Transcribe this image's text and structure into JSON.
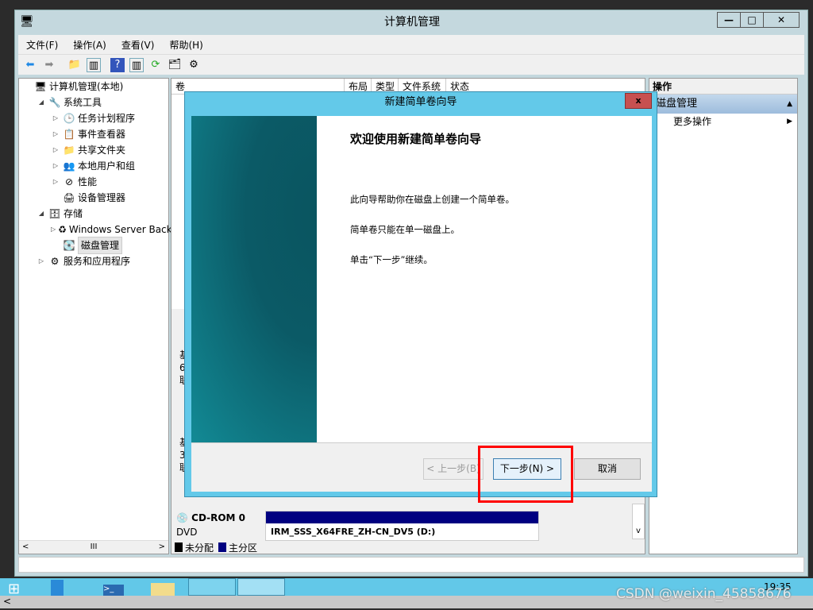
{
  "window": {
    "title": "计算机管理",
    "min": "—",
    "max": "□",
    "close": "✕"
  },
  "menu": [
    "文件(F)",
    "操作(A)",
    "查看(V)",
    "帮助(H)"
  ],
  "tree": [
    {
      "label": "计算机管理(本地)",
      "level": 0,
      "exp": "",
      "icon": "🖥"
    },
    {
      "label": "系统工具",
      "level": 1,
      "exp": "◢",
      "icon": "🔧"
    },
    {
      "label": "任务计划程序",
      "level": 2,
      "exp": "▷",
      "icon": "🕒"
    },
    {
      "label": "事件查看器",
      "level": 2,
      "exp": "▷",
      "icon": "📋"
    },
    {
      "label": "共享文件夹",
      "level": 2,
      "exp": "▷",
      "icon": "📁"
    },
    {
      "label": "本地用户和组",
      "level": 2,
      "exp": "▷",
      "icon": "👥"
    },
    {
      "label": "性能",
      "level": 2,
      "exp": "▷",
      "icon": "⊘"
    },
    {
      "label": "设备管理器",
      "level": 2,
      "exp": "",
      "icon": "🖨"
    },
    {
      "label": "存储",
      "level": 1,
      "exp": "◢",
      "icon": "🗄"
    },
    {
      "label": "Windows Server Back",
      "level": 2,
      "exp": "▷",
      "icon": "♻"
    },
    {
      "label": "磁盘管理",
      "level": 2,
      "exp": "",
      "icon": "💽",
      "selected": true
    },
    {
      "label": "服务和应用程序",
      "level": 1,
      "exp": "▷",
      "icon": "⚙"
    }
  ],
  "columns": [
    "卷",
    "布局",
    "类型",
    "文件系统",
    "状态"
  ],
  "disks": {
    "disk0_partial": [
      "基",
      "6",
      "联"
    ],
    "disk1_partial": [
      "基",
      "3",
      "联"
    ],
    "cdrom": {
      "name": "CD-ROM 0",
      "type": "DVD",
      "volume": "IRM_SSS_X64FRE_ZH-CN_DV5  (D:)"
    }
  },
  "legend": [
    {
      "label": "未分配",
      "color": "#000000"
    },
    {
      "label": "主分区",
      "color": "#000080"
    }
  ],
  "actions": {
    "header": "操作",
    "section": "磁盘管理",
    "more": "更多操作"
  },
  "dialog": {
    "title": "新建简单卷向导",
    "close": "x",
    "heading": "欢迎使用新建简单卷向导",
    "lines": [
      "此向导帮助你在磁盘上创建一个简单卷。",
      "简单卷只能在单一磁盘上。",
      "单击“下一步”继续。"
    ],
    "back": "< 上一步(B)",
    "next": "下一步(N) >",
    "cancel": "取消"
  },
  "taskbar": {
    "clock": "19:35"
  },
  "watermark": "CSDN @weixin_45858676",
  "colors": {
    "accent": "#63c9e9",
    "highlight": "#ff0000",
    "primary_partition": "#000080"
  }
}
